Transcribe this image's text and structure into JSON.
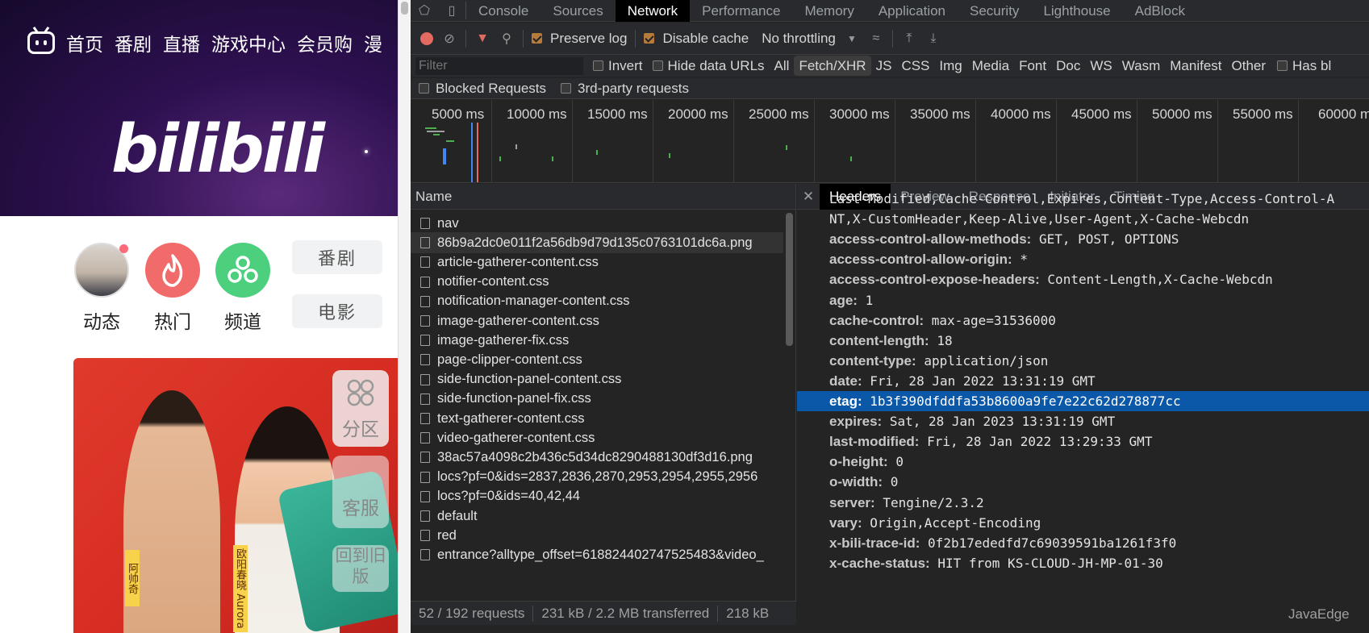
{
  "mobile": {
    "nav": [
      "首页",
      "番剧",
      "直播",
      "游戏中心",
      "会员购",
      "漫"
    ],
    "logo": "bilibili",
    "shortcuts": [
      {
        "label": "动态",
        "icon": "avatar"
      },
      {
        "label": "热门",
        "icon": "flame-icon"
      },
      {
        "label": "频道",
        "icon": "channel-icon"
      }
    ],
    "pills": [
      "番剧",
      "电影"
    ],
    "float_buttons": [
      "分区",
      "客服",
      "回到旧版"
    ],
    "poster_names": [
      "阿帅奇",
      "欧阳春晓 Aurora"
    ]
  },
  "devtools": {
    "tabs": [
      "Console",
      "Sources",
      "Network",
      "Performance",
      "Memory",
      "Application",
      "Security",
      "Lighthouse",
      "AdBlock"
    ],
    "active_tab": "Network",
    "toolbar": {
      "preserve_log": "Preserve log",
      "disable_cache": "Disable cache",
      "throttling": "No throttling"
    },
    "filter": {
      "placeholder": "Filter",
      "invert": "Invert",
      "hide_data_urls": "Hide data URLs",
      "types": [
        "All",
        "Fetch/XHR",
        "JS",
        "CSS",
        "Img",
        "Media",
        "Font",
        "Doc",
        "WS",
        "Wasm",
        "Manifest",
        "Other"
      ],
      "selected_type": "Fetch/XHR",
      "has_blocked": "Has bl",
      "blocked_requests": "Blocked Requests",
      "third_party": "3rd-party requests"
    },
    "timeline_ticks": [
      "5000 ms",
      "10000 ms",
      "15000 ms",
      "20000 ms",
      "25000 ms",
      "30000 ms",
      "35000 ms",
      "40000 ms",
      "45000 ms",
      "50000 ms",
      "55000 ms",
      "60000 m"
    ],
    "name_header": "Name",
    "requests": [
      "nav",
      "86b9a2dc0e011f2a56db9d79d135c0763101dc6a.png",
      "article-gatherer-content.css",
      "notifier-content.css",
      "notification-manager-content.css",
      "image-gatherer-content.css",
      "image-gatherer-fix.css",
      "page-clipper-content.css",
      "side-function-panel-content.css",
      "side-function-panel-fix.css",
      "text-gatherer-content.css",
      "video-gatherer-content.css",
      "38ac57a4098c2b436c5d34dc8290488130df3d16.png",
      "locs?pf=0&ids=2837,2836,2870,2953,2954,2955,2956",
      "locs?pf=0&ids=40,42,44",
      "default",
      "red",
      "entrance?alltype_offset=618824402747525483&video_"
    ],
    "status": {
      "requests": "52 / 192 requests",
      "transferred": "231 kB / 2.2 MB transferred",
      "resources": "218 kB"
    },
    "detail_tabs": [
      "Headers",
      "Preview",
      "Response",
      "Initiator",
      "Timing"
    ],
    "active_detail_tab": "Headers",
    "headers": [
      {
        "k": "",
        "v": "Last-Modified,Cache-Control,Expires,Content-Type,Access-Control-A"
      },
      {
        "k": "",
        "v": "NT,X-CustomHeader,Keep-Alive,User-Agent,X-Cache-Webcdn"
      },
      {
        "k": "access-control-allow-methods:",
        "v": "GET, POST, OPTIONS"
      },
      {
        "k": "access-control-allow-origin:",
        "v": "*"
      },
      {
        "k": "access-control-expose-headers:",
        "v": "Content-Length,X-Cache-Webcdn"
      },
      {
        "k": "age:",
        "v": "1"
      },
      {
        "k": "cache-control:",
        "v": "max-age=31536000"
      },
      {
        "k": "content-length:",
        "v": "18"
      },
      {
        "k": "content-type:",
        "v": "application/json"
      },
      {
        "k": "date:",
        "v": "Fri, 28 Jan 2022 13:31:19 GMT"
      },
      {
        "k": "etag:",
        "v": "1b3f390dfddfa53b8600a9fe7e22c62d278877cc"
      },
      {
        "k": "expires:",
        "v": "Sat, 28 Jan 2023 13:31:19 GMT"
      },
      {
        "k": "last-modified:",
        "v": "Fri, 28 Jan 2022 13:29:33 GMT"
      },
      {
        "k": "o-height:",
        "v": "0"
      },
      {
        "k": "o-width:",
        "v": "0"
      },
      {
        "k": "server:",
        "v": "Tengine/2.3.2"
      },
      {
        "k": "vary:",
        "v": "Origin,Accept-Encoding"
      },
      {
        "k": "x-bili-trace-id:",
        "v": "0f2b17ededfd7c69039591ba1261f3f0"
      },
      {
        "k": "x-cache-status:",
        "v": "HIT from KS-CLOUD-JH-MP-01-30"
      }
    ],
    "selected_header": "etag:",
    "watermark": "JavaEdge"
  },
  "colors": {
    "record": "#e46962",
    "selected_row": "#0b57a8",
    "checkbox_on": "#b67a3b",
    "bili_pink": "#fb7299"
  }
}
